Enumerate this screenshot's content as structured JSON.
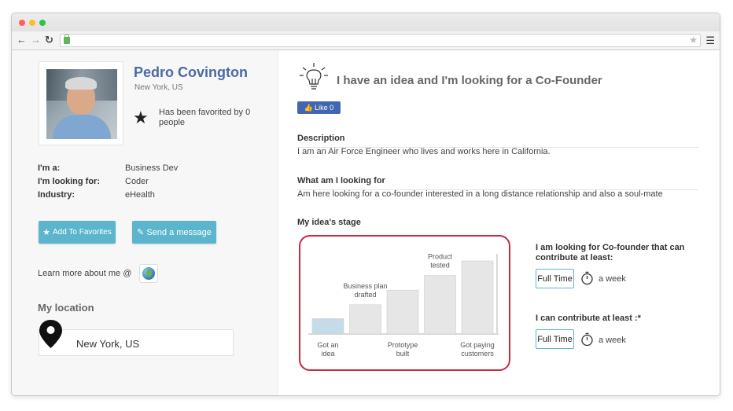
{
  "profile": {
    "name": "Pedro Covington",
    "location": "New York, US",
    "favorited_text": "Has been favorited by 0 people",
    "info": [
      {
        "key": "I'm a:",
        "value": "Business Dev"
      },
      {
        "key": "I'm looking for:",
        "value": "Coder"
      },
      {
        "key": "Industry:",
        "value": "eHealth"
      }
    ],
    "add_favorites_label": "Add To Favorites",
    "send_message_label": "Send a message",
    "learn_more_label": "Learn more about me @",
    "my_location_title": "My location",
    "my_location_value": "New York, US"
  },
  "idea": {
    "title": "I have an idea and I'm looking for a Co-Founder",
    "like_label": "Like 0",
    "description_label": "Description",
    "description_text": "I am an Air Force Engineer who lives and works here in California.",
    "looking_label": "What am I looking for",
    "looking_text": "Am here looking for a co-founder interested in a long distance relationship and also a soul-mate",
    "stage_label": "My idea's stage"
  },
  "chart_data": {
    "type": "bar",
    "categories": [
      "Got an idea",
      "Business plan drafted",
      "Prototype built",
      "Product tested",
      "Got paying customers"
    ],
    "values": [
      1,
      2,
      3,
      4,
      5
    ],
    "highlighted_index": 0,
    "colors": {
      "highlight": "#c5dbe8",
      "default": "#e6e6e6"
    }
  },
  "cofounder": {
    "need_label": "I am looking for Co-founder that can contribute at least:",
    "need_value": "Full Time",
    "need_unit": "a week",
    "give_label": "I can contribute at least :*",
    "give_value": "Full Time",
    "give_unit": "a week"
  },
  "colors": {
    "name": "#4a6aa5",
    "button": "#5bb5cc",
    "facebook": "#4267b2",
    "stage_border": "#c8293f"
  }
}
